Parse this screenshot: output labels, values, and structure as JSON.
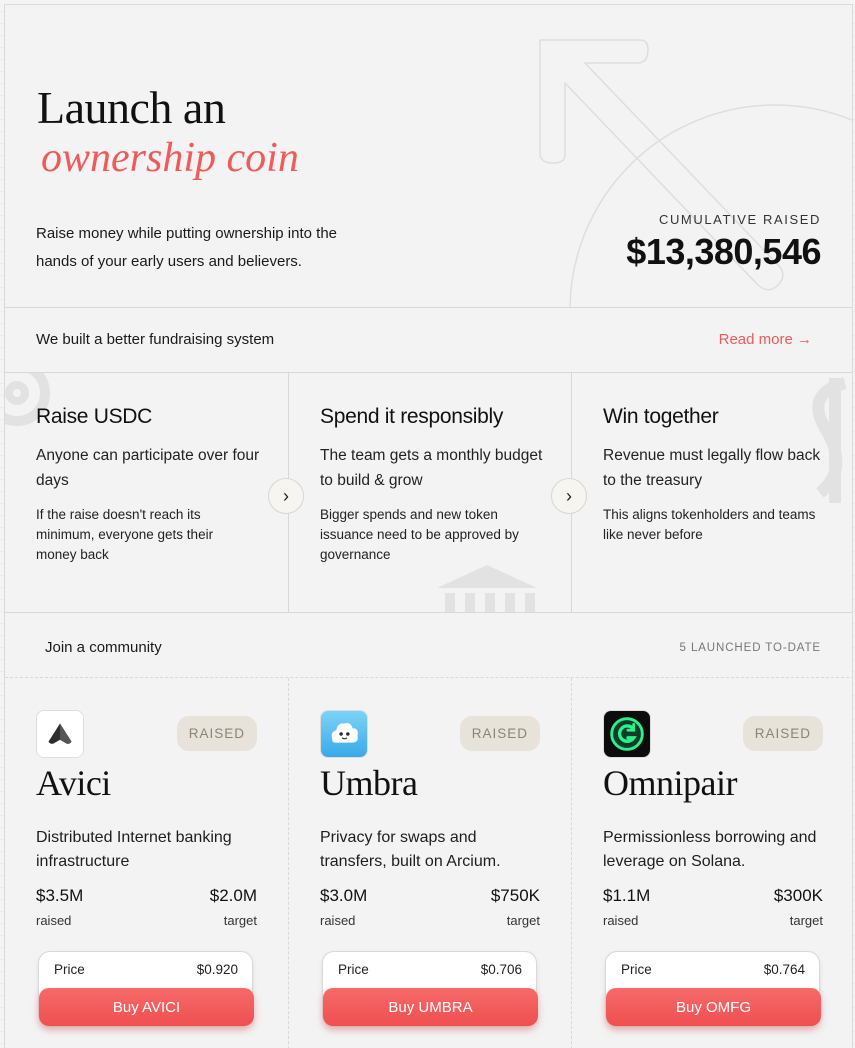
{
  "hero": {
    "title_line1": "Launch an",
    "title_line2": "ownership coin",
    "subtitle": "Raise money while putting ownership into the hands of your early users and believers.",
    "cumulative_label": "CUMULATIVE RAISED",
    "cumulative_value": "$13,380,546"
  },
  "built": {
    "text": "We built a better fundraising system",
    "read_more": "Read more →"
  },
  "features": [
    {
      "title": "Raise USDC",
      "main": "Anyone can participate over four days",
      "detail": "If the raise doesn't reach its minimum, everyone gets their money back"
    },
    {
      "title": "Spend it responsibly",
      "main": "The team gets a monthly budget to build & grow",
      "detail": "Bigger spends and new token issuance need to be approved by governance"
    },
    {
      "title": "Win together",
      "main": "Revenue must legally flow back to the treasury",
      "detail": "This aligns tokenholders and teams like never before"
    }
  ],
  "next_icon": "›",
  "community": {
    "text": "Join a community",
    "launched": "5  LAUNCHED TO-DATE"
  },
  "coins": [
    {
      "logo_icon": "avici-logo-icon",
      "badge": "RAISED",
      "name": "Avici",
      "description": "Distributed Internet banking infrastructure",
      "raised_value": "$3.5M",
      "raised_label": "raised",
      "target_value": "$2.0M",
      "target_label": "target",
      "price_label": "Price",
      "price_value": "$0.920",
      "buy_label": "Buy AVICI"
    },
    {
      "logo_icon": "umbra-logo-icon",
      "badge": "RAISED",
      "name": "Umbra",
      "description": "Privacy for swaps and transfers, built on Arcium.",
      "raised_value": "$3.0M",
      "raised_label": "raised",
      "target_value": "$750K",
      "target_label": "target",
      "price_label": "Price",
      "price_value": "$0.706",
      "buy_label": "Buy UMBRA"
    },
    {
      "logo_icon": "omnipair-logo-icon",
      "badge": "RAISED",
      "name": "Omnipair",
      "description": "Permissionless borrowing and leverage on Solana.",
      "raised_value": "$1.1M",
      "raised_label": "raised",
      "target_value": "$300K",
      "target_label": "target",
      "price_label": "Price",
      "price_value": "$0.764",
      "buy_label": "Buy OMFG"
    }
  ],
  "colors": {
    "accent": "#ef5a5a",
    "badge_bg": "#e7e3da",
    "background": "#f3f3f3"
  }
}
